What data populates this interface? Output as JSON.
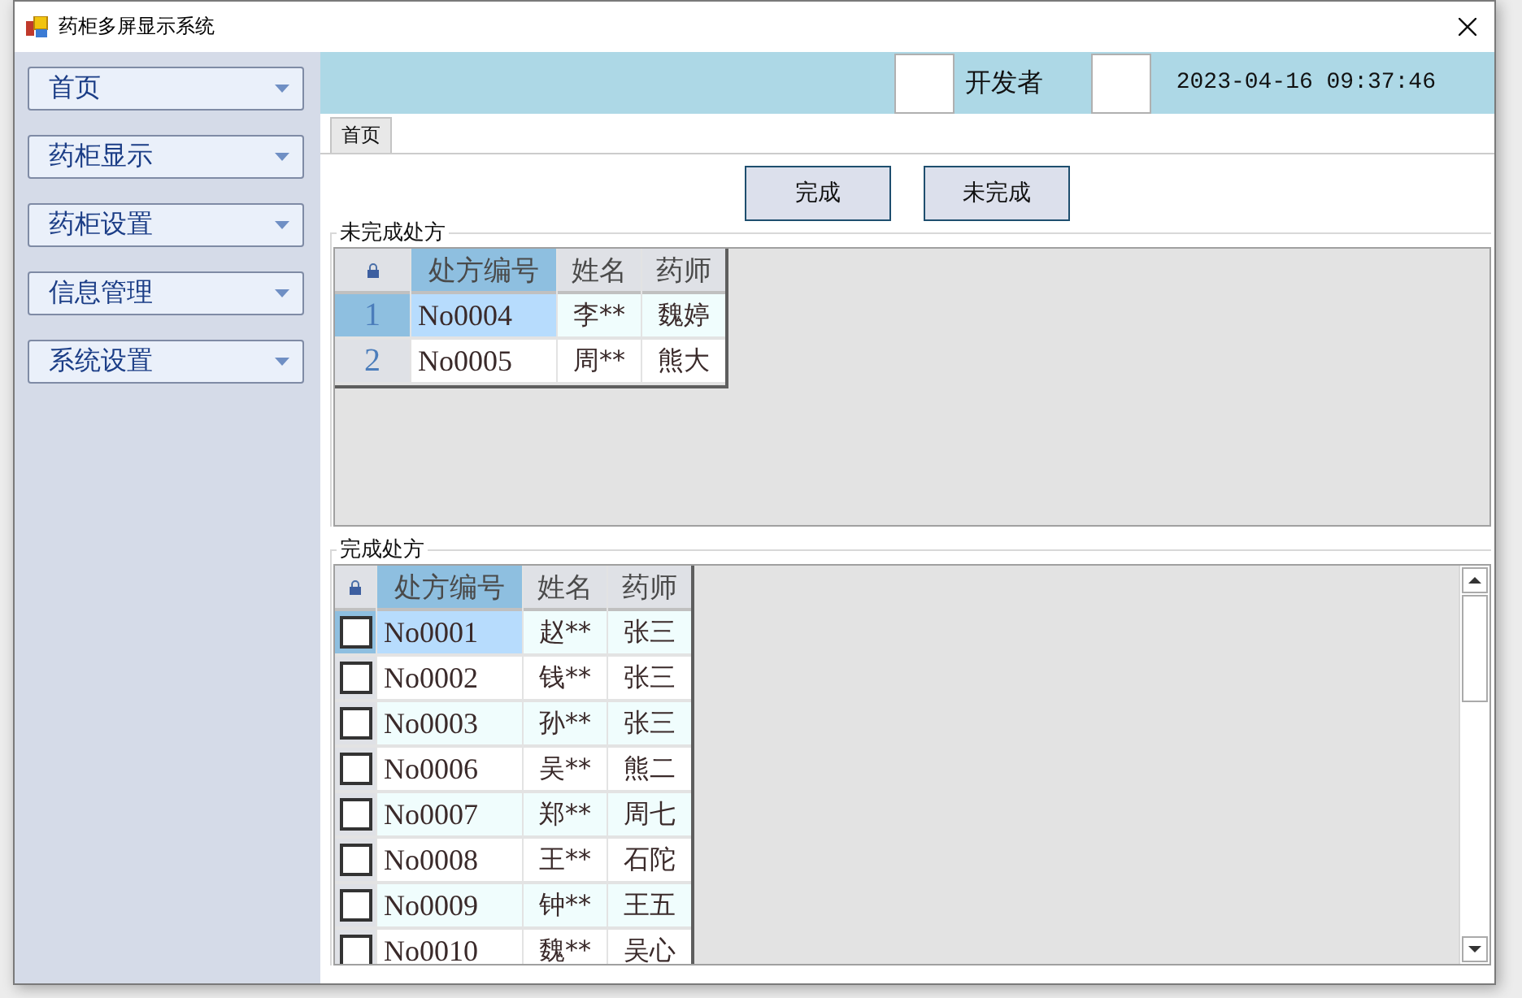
{
  "window": {
    "title": "药柜多屏显示系统"
  },
  "sidebar": {
    "items": [
      {
        "label": "首页"
      },
      {
        "label": "药柜显示"
      },
      {
        "label": "药柜设置"
      },
      {
        "label": "信息管理"
      },
      {
        "label": "系统设置"
      }
    ]
  },
  "header": {
    "user": "开发者",
    "datetime": "2023-04-16 09:37:46"
  },
  "tabs": [
    {
      "label": "首页",
      "selected": true
    }
  ],
  "buttons": [
    "完成",
    "未完成"
  ],
  "pending": {
    "title": "未完成处方",
    "columns": [
      "处方编号",
      "姓名",
      "药师"
    ],
    "rows": [
      {
        "row_number": "1",
        "selected": true,
        "cells": [
          "No0004",
          "李**",
          "魏婷"
        ]
      },
      {
        "row_number": "2",
        "selected": false,
        "cells": [
          "No0005",
          "周**",
          "熊大"
        ]
      }
    ]
  },
  "completed": {
    "title": "完成处方",
    "columns": [
      "处方编号",
      "姓名",
      "药师"
    ],
    "rows": [
      {
        "checked": false,
        "selected": true,
        "cells": [
          "No0001",
          "赵**",
          "张三"
        ]
      },
      {
        "checked": false,
        "selected": false,
        "cells": [
          "No0002",
          "钱**",
          "张三"
        ]
      },
      {
        "checked": false,
        "selected": false,
        "cells": [
          "No0003",
          "孙**",
          "张三"
        ]
      },
      {
        "checked": false,
        "selected": false,
        "cells": [
          "No0006",
          "吴**",
          "熊二"
        ]
      },
      {
        "checked": false,
        "selected": false,
        "cells": [
          "No0007",
          "郑**",
          "周七"
        ]
      },
      {
        "checked": false,
        "selected": false,
        "cells": [
          "No0008",
          "王**",
          "石陀"
        ]
      },
      {
        "checked": false,
        "selected": false,
        "cells": [
          "No0009",
          "钟**",
          "王五"
        ]
      },
      {
        "checked": false,
        "selected": false,
        "cells": [
          "No0010",
          "魏**",
          "吴心"
        ]
      }
    ]
  }
}
